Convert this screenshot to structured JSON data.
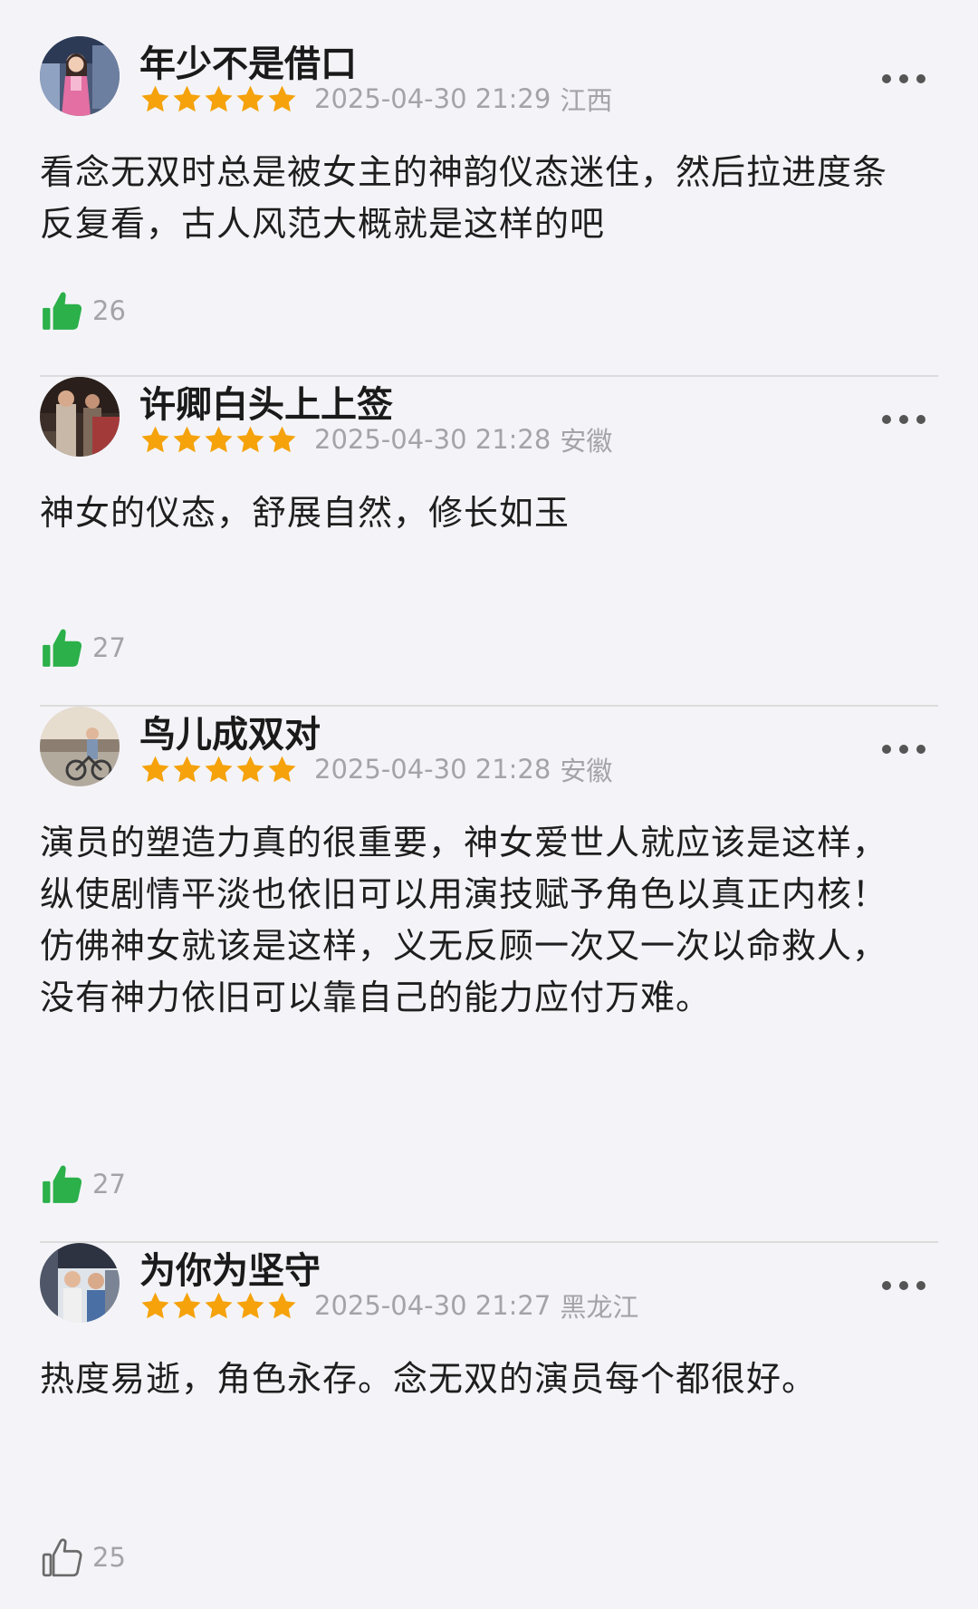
{
  "colors": {
    "star": "#f5a20b",
    "like_active": "#2bb04a",
    "like_inactive": "#6a6a6a",
    "meta_text": "#a4a4a8",
    "background": "#f4f4f8"
  },
  "comments": [
    {
      "username": "年少不是借口",
      "rating": 5,
      "datetime": "2025-04-30 21:29",
      "location": "江西",
      "text": "看念无双时总是被女主的神韵仪态迷住，然后拉进度条反复看，古人风范大概就是这样的吧",
      "likes": "26",
      "liked": true,
      "avatar_icon": "user-avatar-icon"
    },
    {
      "username": "许卿白头上上签",
      "rating": 5,
      "datetime": "2025-04-30 21:28",
      "location": "安徽",
      "text": "神女的仪态，舒展自然，修长如玉",
      "likes": "27",
      "liked": true,
      "avatar_icon": "user-avatar-icon"
    },
    {
      "username": "鸟儿成双对",
      "rating": 5,
      "datetime": "2025-04-30 21:28",
      "location": "安徽",
      "text": "演员的塑造力真的很重要，神女爱世人就应该是这样，纵使剧情平淡也依旧可以用演技赋予角色以真正内核！仿佛神女就该是这样，义无反顾一次又一次以命救人，没有神力依旧可以靠自己的能力应付万难。",
      "likes": "27",
      "liked": true,
      "avatar_icon": "user-avatar-icon"
    },
    {
      "username": "为你为坚守",
      "rating": 5,
      "datetime": "2025-04-30 21:27",
      "location": "黑龙江",
      "text": "热度易逝，角色永存。念无双的演员每个都很好。",
      "likes": "25",
      "liked": false,
      "avatar_icon": "user-avatar-icon"
    }
  ]
}
